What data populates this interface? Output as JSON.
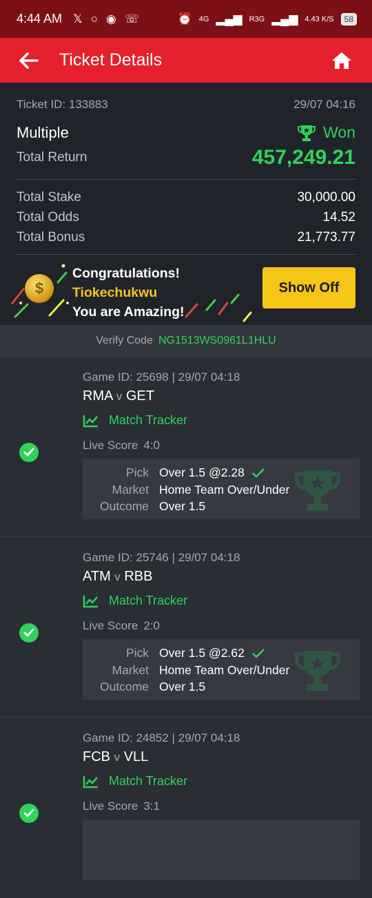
{
  "status_bar": {
    "time": "4:44 AM",
    "net1": "4G",
    "net2": "R3G",
    "speed": "4.43",
    "speed_unit": "K/S",
    "battery": "58"
  },
  "app_bar": {
    "title": "Ticket Details"
  },
  "summary": {
    "ticket_id_label": "Ticket ID:",
    "ticket_id": "133883",
    "date": "29/07 04:16",
    "bet_type": "Multiple",
    "status": "Won",
    "total_return_label": "Total Return",
    "total_return": "457,249.21",
    "total_stake_label": "Total Stake",
    "total_stake": "30,000.00",
    "total_odds_label": "Total Odds",
    "total_odds": "14.52",
    "total_bonus_label": "Total Bonus",
    "total_bonus": "21,773.77"
  },
  "promo": {
    "line1": "Congratulations!",
    "name": "Tiokechukwu",
    "line3": "You are Amazing!",
    "button": "Show Off"
  },
  "verify": {
    "label": "Verify Code",
    "code": "NG1513WS0961L1HLU"
  },
  "games": [
    {
      "meta": "Game ID: 25698 | 29/07 04:18",
      "home": "RMA",
      "vs": "v",
      "away": "GET",
      "tracker": "Match Tracker",
      "live_label": "Live Score",
      "live_score": "4:0",
      "pick_label": "Pick",
      "pick": "Over 1.5 @2.28",
      "market_label": "Market",
      "market": "Home Team Over/Under",
      "outcome_label": "Outcome",
      "outcome": "Over 1.5"
    },
    {
      "meta": "Game ID: 25746 | 29/07 04:18",
      "home": "ATM",
      "vs": "v",
      "away": "RBB",
      "tracker": "Match Tracker",
      "live_label": "Live Score",
      "live_score": "2:0",
      "pick_label": "Pick",
      "pick": "Over 1.5 @2.62",
      "market_label": "Market",
      "market": "Home Team Over/Under",
      "outcome_label": "Outcome",
      "outcome": "Over 1.5"
    },
    {
      "meta": "Game ID: 24852 | 29/07 04:18",
      "home": "FCB",
      "vs": "v",
      "away": "VLL",
      "tracker": "Match Tracker",
      "live_label": "Live Score",
      "live_score": "3:1"
    }
  ],
  "colors": {
    "brand_red": "#e4202c",
    "status_red": "#7d0f16",
    "win_green": "#2fd35a",
    "accent_yellow": "#f5c518"
  }
}
